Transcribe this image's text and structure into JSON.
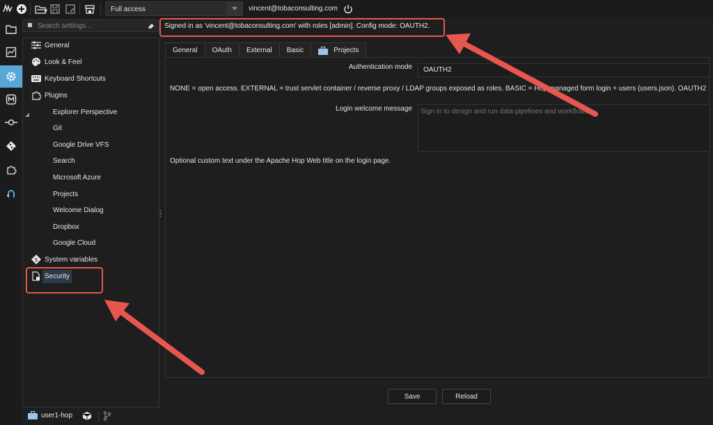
{
  "toolbar": {
    "access_mode": "Full access",
    "user_email": "vincent@tobaconsulting.com"
  },
  "search": {
    "placeholder": "Search settings..."
  },
  "sidebar": {
    "items": [
      {
        "label": "General",
        "icon": "sliders-icon"
      },
      {
        "label": "Look & Feel",
        "icon": "palette-icon"
      },
      {
        "label": "Keyboard Shortcuts",
        "icon": "keyboard-icon"
      },
      {
        "label": "Plugins",
        "icon": "puzzle-icon"
      },
      {
        "label": "Explorer Perspective"
      },
      {
        "label": "Git"
      },
      {
        "label": "Google Drive VFS"
      },
      {
        "label": "Search"
      },
      {
        "label": "Microsoft Azure"
      },
      {
        "label": "Projects"
      },
      {
        "label": "Welcome Dialog"
      },
      {
        "label": "Dropbox"
      },
      {
        "label": "Google Cloud"
      },
      {
        "label": "System variables",
        "icon": "variable-icon"
      },
      {
        "label": "Security",
        "icon": "document-lock-icon"
      }
    ]
  },
  "status": {
    "project": "user1-hop"
  },
  "main": {
    "signed_in_message": "Signed in as 'vincent@tobaconsulting.com' with roles [admin]. Config mode: OAUTH2.",
    "tabs": [
      {
        "label": "General"
      },
      {
        "label": "OAuth"
      },
      {
        "label": "External"
      },
      {
        "label": "Basic"
      },
      {
        "label": "Projects"
      }
    ],
    "auth_mode_label": "Authentication mode",
    "auth_mode_value": "OAUTH2",
    "auth_help": "NONE = open access. EXTERNAL = trust servlet container / reverse proxy / LDAP groups exposed as roles. BASIC = Hop-managed form login + users (users.json). OAUTH2",
    "welcome_label": "Login welcome message",
    "welcome_placeholder": "Sign in to design and run data pipelines and workflows.",
    "welcome_help": "Optional custom text under the Apache Hop Web title on the login page.",
    "save_label": "Save",
    "reload_label": "Reload"
  },
  "colors": {
    "accent": "#5aa7d6",
    "annotation": "#e8574f",
    "background": "#1e1e1f"
  }
}
